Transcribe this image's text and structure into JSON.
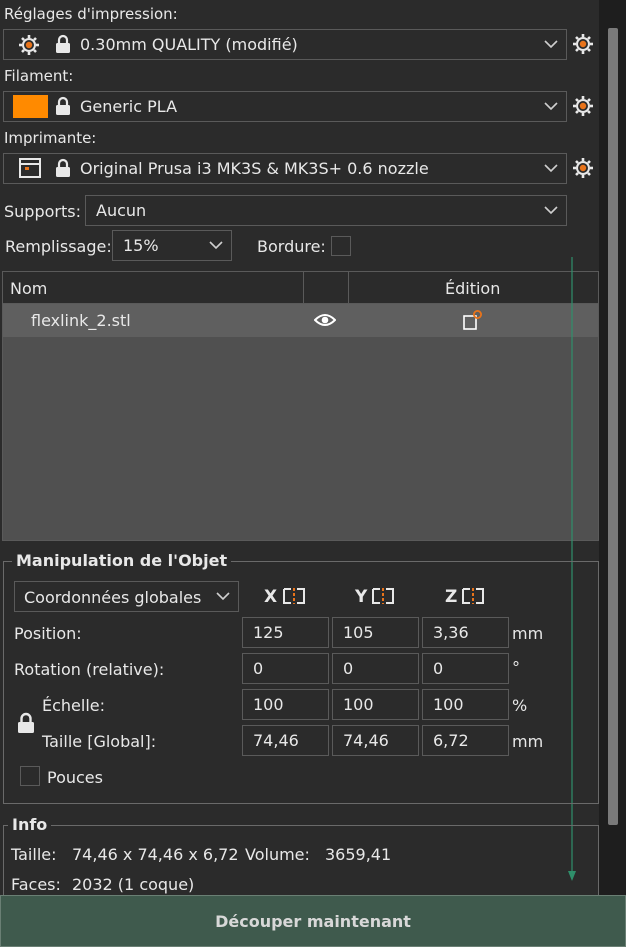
{
  "print_settings": {
    "label": "Réglages d'impression:",
    "value": "0.30mm QUALITY (modifié)"
  },
  "filament": {
    "label": "Filament:",
    "value": "Generic PLA",
    "color": "#ff8a00"
  },
  "printer": {
    "label": "Imprimante:",
    "value": "Original Prusa i3 MK3S & MK3S+ 0.6 nozzle"
  },
  "supports": {
    "label": "Supports:",
    "value": "Aucun"
  },
  "infill": {
    "label": "Remplissage:",
    "value": "15%"
  },
  "brim": {
    "label": "Bordure:"
  },
  "object_list": {
    "col_name": "Nom",
    "col_edit": "Édition",
    "rows": [
      {
        "name": "flexlink_2.stl"
      }
    ]
  },
  "manip": {
    "title": "Manipulation de l'Objet",
    "coords": "Coordonnées globales",
    "x": "X",
    "y": "Y",
    "z": "Z",
    "position": {
      "label": "Position:",
      "x": "125",
      "y": "105",
      "z": "3,36",
      "unit": "mm"
    },
    "rotation": {
      "label": "Rotation (relative):",
      "x": "0",
      "y": "0",
      "z": "0",
      "unit": "°"
    },
    "scale": {
      "label": "Échelle:",
      "x": "100",
      "y": "100",
      "z": "100",
      "unit": "%"
    },
    "size": {
      "label": "Taille [Global]:",
      "x": "74,46",
      "y": "74,46",
      "z": "6,72",
      "unit": "mm"
    },
    "inches": "Pouces"
  },
  "info": {
    "title": "Info",
    "size_label": "Taille:",
    "size_value": "74,46 x 74,46 x 6,72",
    "volume_label": "Volume:",
    "volume_value": "3659,41",
    "faces_label": "Faces:",
    "faces_value": "2032 (1 coque)"
  },
  "slice_button": "Découper maintenant",
  "colors": {
    "accent_orange": "#e8731a",
    "arrow_green": "#2f8f6b",
    "button_bg": "#3f5a4d"
  }
}
